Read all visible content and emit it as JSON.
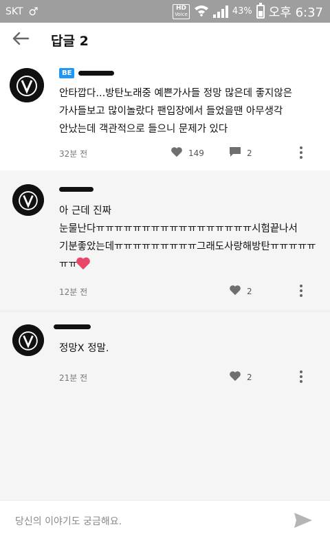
{
  "status_bar": {
    "carrier": "SKT",
    "hd_label": "HD",
    "voice_label": "Voice",
    "battery": "43%",
    "time": "오후 6:37"
  },
  "header": {
    "title": "답글 2"
  },
  "main_comment": {
    "badge": "BE",
    "text": "안타깝다...방탄노래중 예쁜가사들 정망 많은데 좋지않은\n가사들보고 많이놀랐다 팬입장에서 들었을땐 아무생각\n안났는데 객관적으로 들으니 문제가 있다",
    "time": "32분 전",
    "likes": "149",
    "replies": "2"
  },
  "replies": [
    {
      "text": "아 근데 진짜\n눈물난다ㅠㅠㅠㅠㅠㅠㅠㅠㅠㅠㅠㅠㅠㅠㅠㅠㅠ시험끝나서\n기분좋았는데ㅠㅠㅠㅠㅠㅠㅠㅠㅠ그래도사랑해방탄ㅠㅠㅠㅠㅠ\nㅠㅠ",
      "time": "12분 전",
      "likes": "2"
    },
    {
      "text": "정망X 정말.",
      "time": "21분 전",
      "likes": "2"
    }
  ],
  "input": {
    "placeholder": "당신의 이야기도 궁금해요."
  },
  "icons": {
    "back": "arrow-left-icon",
    "heart": "heart-icon",
    "comment": "comment-bubble-icon",
    "more": "more-vertical-icon",
    "send": "send-icon"
  },
  "colors": {
    "status_bar": "#9e9e9e",
    "badge": "#2196f3",
    "reply_bg": "#f5f5f5",
    "emoji_heart": "#e8476a"
  }
}
